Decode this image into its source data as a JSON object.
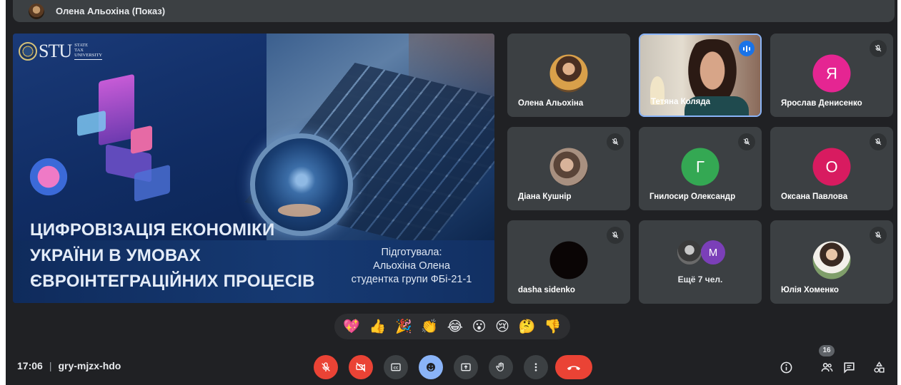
{
  "presenter_bar": {
    "title": "Олена Альохіна (Показ)"
  },
  "slide": {
    "logo_main": "STU",
    "logo_sub": [
      "STATE",
      "TAX",
      "UNIVERSITY"
    ],
    "title_lines": [
      "ЦИФРОВІЗАЦІЯ ЕКОНОМІКИ",
      "УКРАЇНИ В УМОВАХ",
      "ЄВРОІНТЕГРАЦІЙНИХ ПРОЦЕСІВ"
    ],
    "author_lines": [
      "Підготувала:",
      "Альохіна Олена",
      "студентка групи ФБі-21-1"
    ]
  },
  "participants": [
    {
      "name": "Олена Альохіна",
      "avatar": "photo",
      "muted": false
    },
    {
      "name": "Тетяна Коляда",
      "avatar": "video",
      "muted": false,
      "speaking": true
    },
    {
      "name": "Ярослав Денисенко",
      "avatar": "letter",
      "letter": "Я",
      "color": "#e52592",
      "muted": true
    },
    {
      "name": "Діана Кушнір",
      "avatar": "photo",
      "muted": true
    },
    {
      "name": "Гнилосир Олександр",
      "avatar": "letter",
      "letter": "Г",
      "color": "#34a853",
      "muted": true
    },
    {
      "name": "Оксана Павлова",
      "avatar": "letter",
      "letter": "О",
      "color": "#d81b60",
      "muted": true
    },
    {
      "name": "dasha sidenko",
      "avatar": "photo",
      "muted": true
    },
    {
      "name": "Ещё 7 чел.",
      "avatar": "group",
      "letter": "M",
      "color": "#7b3fb8",
      "muted": false
    },
    {
      "name": "Юлія Хоменко",
      "avatar": "photo",
      "muted": true
    }
  ],
  "reactions": [
    "💖",
    "👍",
    "🎉",
    "👏",
    "😂",
    "😮",
    "😢",
    "🤔",
    "👎"
  ],
  "bottom": {
    "time": "17:06",
    "meeting_code": "gry-mjzx-hdo",
    "participants_count": "16"
  },
  "colors": {
    "accent": "#8ab4f8",
    "danger": "#ea4335",
    "surface": "#3c4043",
    "background": "#202124"
  },
  "icons": [
    "mic-off-icon",
    "camera-off-icon",
    "captions-icon",
    "emoji-icon",
    "present-icon",
    "raise-hand-icon",
    "more-icon",
    "hang-up-icon",
    "info-icon",
    "people-icon",
    "chat-icon",
    "activities-icon"
  ]
}
